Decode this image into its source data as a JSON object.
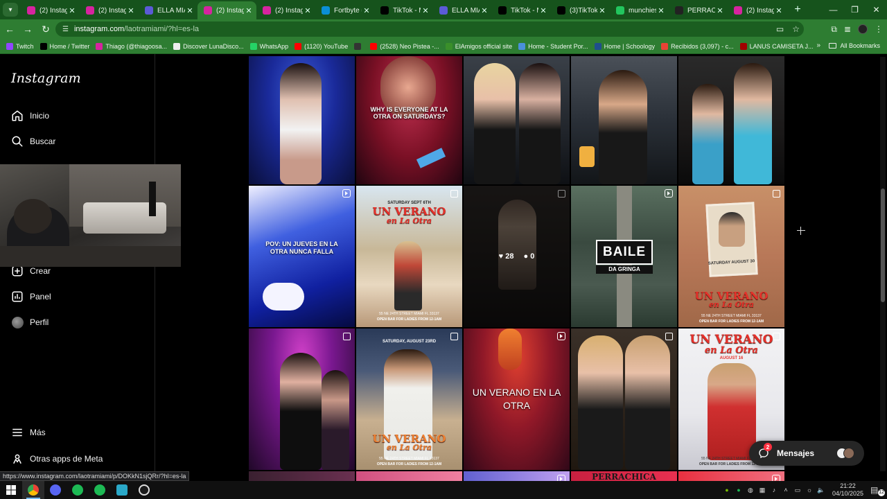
{
  "browser": {
    "tabs": [
      {
        "label": "(2) Instagr",
        "favicon": "instagram-icon",
        "color": "#d6249f",
        "active": false
      },
      {
        "label": "(2) Instagr",
        "favicon": "instagram-icon",
        "color": "#d6249f",
        "active": false
      },
      {
        "label": "ELLA MIAM",
        "favicon": "triangle-icon",
        "color": "#5b5bd6",
        "active": false
      },
      {
        "label": "(2) Instagr",
        "favicon": "instagram-icon",
        "color": "#d6249f",
        "active": true
      },
      {
        "label": "(2) Instagr",
        "favicon": "instagram-icon",
        "color": "#d6249f",
        "active": false
      },
      {
        "label": "Fortbyte #",
        "favicon": "fortbyte-icon",
        "color": "#0b8fd6",
        "active": false
      },
      {
        "label": "TikTok - M",
        "favicon": "tiktok-icon",
        "color": "#000000",
        "active": false
      },
      {
        "label": "ELLA MIAM",
        "favicon": "triangle-icon",
        "color": "#5b5bd6",
        "active": false
      },
      {
        "label": "TikTok - M",
        "favicon": "tiktok-icon",
        "color": "#000000",
        "active": false
      },
      {
        "label": "(3)TikTok",
        "favicon": "tiktok-icon",
        "color": "#000000",
        "active": false
      },
      {
        "label": "munchies",
        "favicon": "munchies-icon",
        "color": "#22c55e",
        "active": false
      },
      {
        "label": "PERRACHI",
        "favicon": "doc-icon",
        "color": "#222222",
        "active": false
      },
      {
        "label": "(2) Instagr",
        "favicon": "instagram-icon",
        "color": "#d6249f",
        "active": false
      }
    ],
    "new_tab": "+",
    "url_host": "instagram.com",
    "url_path": "/laotramiami/?hl=es-la",
    "bookmarks": [
      {
        "label": "Twitch",
        "color": "#9146ff"
      },
      {
        "label": "Home / Twitter",
        "color": "#000000"
      },
      {
        "label": "Thiago (@thiagoosa...",
        "color": "#d6249f"
      },
      {
        "label": "Discover LunaDisco...",
        "color": "#eeeeee"
      },
      {
        "label": "WhatsApp",
        "color": "#25d366"
      },
      {
        "label": "(1120) YouTube",
        "color": "#ff0000"
      },
      {
        "label": "",
        "color": "#333333"
      },
      {
        "label": "(2528) Neo Pistea -...",
        "color": "#ff0000"
      },
      {
        "label": "ElAmigos official site",
        "color": "#3a8f2a"
      },
      {
        "label": "Home - Student Por...",
        "color": "#4a90d9"
      },
      {
        "label": "Home | Schoology",
        "color": "#1f4e8c"
      },
      {
        "label": "Recibidos (3,097) - c...",
        "color": "#ea4335"
      },
      {
        "label": "LANUS CAMISETA J...",
        "color": "#a00000"
      }
    ],
    "bookmarks_more": "»",
    "all_bookmarks": "All Bookmarks",
    "status_url": "https://www.instagram.com/laotramiami/p/DOKkN1sjQRr/?hl=es-la"
  },
  "sidebar": {
    "logo": "Instagram",
    "items_top": [
      {
        "label": "Inicio",
        "icon": "home-icon"
      },
      {
        "label": "Buscar",
        "icon": "search-icon"
      }
    ],
    "items_mid": [
      {
        "label": "Crear",
        "icon": "create-icon"
      },
      {
        "label": "Panel",
        "icon": "dashboard-icon"
      },
      {
        "label": "Perfil",
        "icon": "profile-avatar"
      }
    ],
    "items_bottom": [
      {
        "label": "Más",
        "icon": "menu-icon"
      },
      {
        "label": "Otras apps de Meta",
        "icon": "meta-icon"
      }
    ]
  },
  "posts": [
    {
      "type": "photo",
      "caption": ""
    },
    {
      "type": "photo",
      "caption": "WHY IS EVERYONE AT LA OTRA ON SATURDAYS?"
    },
    {
      "type": "photo",
      "caption": ""
    },
    {
      "type": "photo",
      "caption": ""
    },
    {
      "type": "photo",
      "caption": ""
    },
    {
      "type": "reel",
      "caption": "POV: UN JUEVES EN LA OTRA NUNCA FALLA"
    },
    {
      "type": "carousel",
      "title": "UN VERANO",
      "script": "en La Otra",
      "top": "SATURDAY SEPT 6TH",
      "bottom": "55 NE 24TH STREET MIAMI FL 33137",
      "bottom2": "OPEN BAR FOR LADIES FROM 12-1AM"
    },
    {
      "type": "carousel",
      "likes": "28",
      "comments": "0"
    },
    {
      "type": "reel",
      "title": "BAILE",
      "sub": "DA GRINGA"
    },
    {
      "type": "carousel",
      "title": "UN VERANO",
      "script": "en La Otra",
      "date": "SATURDAY AUGUST 30",
      "bottom": "55 NE 24TH STREET MIAMI FL 33137",
      "bottom2": "OPEN BAR FOR LADIES FROM 12-1AM"
    },
    {
      "type": "carousel",
      "caption": ""
    },
    {
      "type": "carousel",
      "title": "UN VERANO",
      "script": "en La Otra",
      "top": "SATURDAY, AUGUST 23RD",
      "bottom": "55 NE 24TH STREET MIAMI FL 33137",
      "bottom2": "OPEN BAR FOR LADIES FROM 12-1AM"
    },
    {
      "type": "reel",
      "caption": "UN VERANO EN LA OTRA"
    },
    {
      "type": "carousel",
      "caption": ""
    },
    {
      "type": "photo",
      "title": "UN VERANO",
      "script": "en La Otra",
      "top": "AUGUST 16",
      "bottom": "55 NE 24TH STREET MIAMI FL 33137",
      "bottom2": "OPEN BAR FOR LADIES FROM 12-1AM"
    }
  ],
  "bottom_row_partial": "PERRACHICA",
  "messages": {
    "label": "Mensajes",
    "badge": "2"
  },
  "taskbar": {
    "time": "21:22",
    "date": "04/10/2025",
    "notifications": "12"
  }
}
